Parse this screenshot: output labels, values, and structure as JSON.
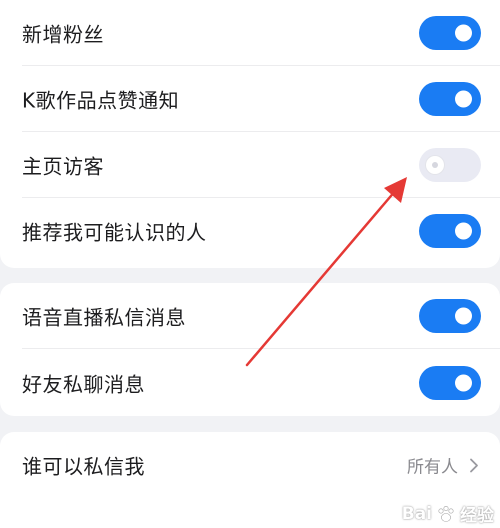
{
  "settings": {
    "group1": [
      {
        "label": "新增粉丝",
        "enabled": true
      },
      {
        "label": "K歌作品点赞通知",
        "enabled": true
      },
      {
        "label": "主页访客",
        "enabled": false
      },
      {
        "label": "推荐我可能认识的人",
        "enabled": true
      }
    ],
    "group2": [
      {
        "label": "语音直播私信消息",
        "enabled": true
      },
      {
        "label": "好友私聊消息",
        "enabled": true
      }
    ],
    "group3": [
      {
        "label": "谁可以私信我",
        "value": "所有人"
      }
    ]
  },
  "icons": {
    "chevron": "chevron-right-icon",
    "annotation": "red-arrow-annotation",
    "watermark_logo": "baidu-paw-icon"
  },
  "colors": {
    "toggle_on": "#1a7cf3",
    "toggle_off": "#e9eaf3",
    "annotation_arrow": "#e53935",
    "page_background": "#f1f2f5"
  },
  "watermark": {
    "text_prefix": "Bai",
    "text_suffix": "经验"
  }
}
